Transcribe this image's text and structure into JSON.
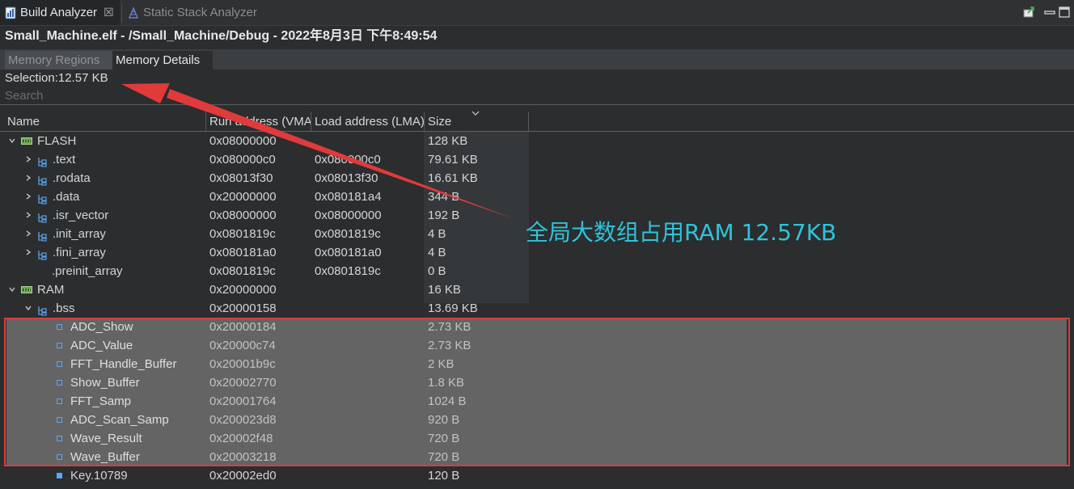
{
  "view_tabs": [
    {
      "label": "Build Analyzer",
      "icon": "build-analyzer-icon",
      "active": true,
      "close": "☒"
    },
    {
      "label": "Static Stack Analyzer",
      "icon": "stack-analyzer-icon",
      "active": false
    }
  ],
  "header": {
    "title": "Small_Machine.elf - /Small_Machine/Debug - 2022年8月3日 下午8:49:54"
  },
  "inner_tabs": [
    {
      "label": "Memory Regions",
      "active": false
    },
    {
      "label": "Memory Details",
      "active": true
    }
  ],
  "selection": "Selection:12.57 KB",
  "search": {
    "placeholder": "Search"
  },
  "columns": {
    "name": "Name",
    "vma": "Run address (VMA)",
    "lma": "Load address (LMA)",
    "size": "Size"
  },
  "rows": [
    {
      "name": "FLASH",
      "vma": "0x08000000",
      "lma": "",
      "size": "128 KB",
      "icon": "memory-region-icon",
      "expand": "expanded"
    },
    {
      "name": ".text",
      "vma": "0x080000c0",
      "lma": "0x080000c0",
      "size": "79.61 KB",
      "icon": "section-icon",
      "expand": "collapsed"
    },
    {
      "name": ".rodata",
      "vma": "0x08013f30",
      "lma": "0x08013f30",
      "size": "16.61 KB",
      "icon": "section-icon",
      "expand": "collapsed"
    },
    {
      "name": ".data",
      "vma": "0x20000000",
      "lma": "0x080181a4",
      "size": "344 B",
      "icon": "section-icon",
      "expand": "collapsed"
    },
    {
      "name": ".isr_vector",
      "vma": "0x08000000",
      "lma": "0x08000000",
      "size": "192 B",
      "icon": "section-icon",
      "expand": "collapsed"
    },
    {
      "name": ".init_array",
      "vma": "0x0801819c",
      "lma": "0x0801819c",
      "size": "4 B",
      "icon": "section-icon",
      "expand": "collapsed"
    },
    {
      "name": ".fini_array",
      "vma": "0x080181a0",
      "lma": "0x080181a0",
      "size": "4 B",
      "icon": "section-icon",
      "expand": "collapsed"
    },
    {
      "name": ".preinit_array",
      "vma": "0x0801819c",
      "lma": "0x0801819c",
      "size": "0 B",
      "icon": "none",
      "expand": "none"
    },
    {
      "name": "RAM",
      "vma": "0x20000000",
      "lma": "",
      "size": "16 KB",
      "icon": "memory-region-icon",
      "expand": "expanded"
    },
    {
      "name": ".bss",
      "vma": "0x20000158",
      "lma": "",
      "size": "13.69 KB",
      "icon": "section-icon",
      "expand": "expanded"
    },
    {
      "name": "ADC_Show",
      "vma": "0x20000184",
      "lma": "",
      "size": "2.73 KB",
      "icon": "symbol-icon",
      "expand": "none",
      "selected": true
    },
    {
      "name": "ADC_Value",
      "vma": "0x20000c74",
      "lma": "",
      "size": "2.73 KB",
      "icon": "symbol-icon",
      "expand": "none",
      "selected": true
    },
    {
      "name": "FFT_Handle_Buffer",
      "vma": "0x20001b9c",
      "lma": "",
      "size": "2 KB",
      "icon": "symbol-icon",
      "expand": "none",
      "selected": true
    },
    {
      "name": "Show_Buffer",
      "vma": "0x20002770",
      "lma": "",
      "size": "1.8 KB",
      "icon": "symbol-icon",
      "expand": "none",
      "selected": true
    },
    {
      "name": "FFT_Samp",
      "vma": "0x20001764",
      "lma": "",
      "size": "1024 B",
      "icon": "symbol-icon",
      "expand": "none",
      "selected": true
    },
    {
      "name": "ADC_Scan_Samp",
      "vma": "0x200023d8",
      "lma": "",
      "size": "920 B",
      "icon": "symbol-icon",
      "expand": "none",
      "selected": true
    },
    {
      "name": "Wave_Result",
      "vma": "0x20002f48",
      "lma": "",
      "size": "720 B",
      "icon": "symbol-icon",
      "expand": "none",
      "selected": true
    },
    {
      "name": "Wave_Buffer",
      "vma": "0x20003218",
      "lma": "",
      "size": "720 B",
      "icon": "symbol-icon",
      "expand": "none",
      "selected": true
    },
    {
      "name": "Key.10789",
      "vma": "0x20002ed0",
      "lma": "",
      "size": "120 B",
      "icon": "symbol-filled-icon",
      "expand": "none"
    }
  ],
  "annotation": {
    "text": "全局大数组占用RAM 12.57KB",
    "color": "#2ec4d9",
    "arrow_color": "#e03a3a"
  }
}
